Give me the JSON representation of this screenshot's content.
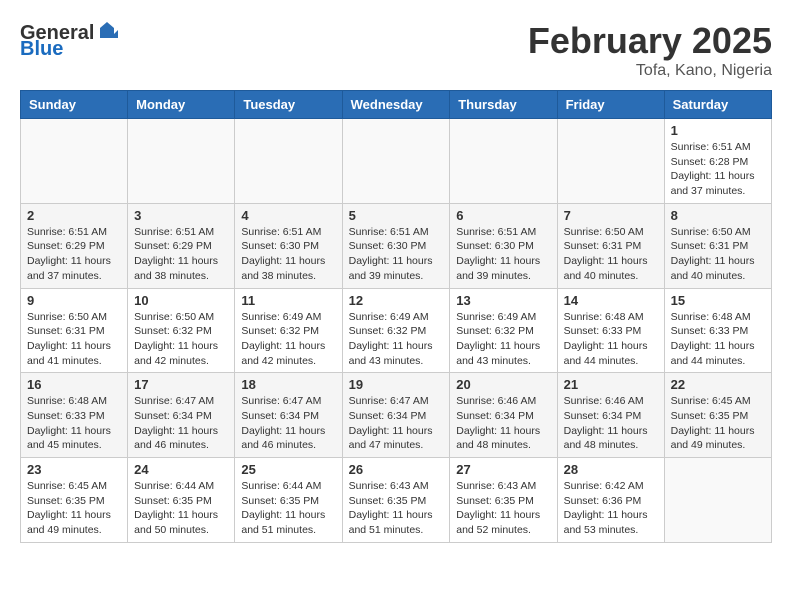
{
  "header": {
    "logo_general": "General",
    "logo_blue": "Blue",
    "month_year": "February 2025",
    "location": "Tofa, Kano, Nigeria"
  },
  "weekdays": [
    "Sunday",
    "Monday",
    "Tuesday",
    "Wednesday",
    "Thursday",
    "Friday",
    "Saturday"
  ],
  "weeks": [
    [
      {
        "day": "",
        "info": ""
      },
      {
        "day": "",
        "info": ""
      },
      {
        "day": "",
        "info": ""
      },
      {
        "day": "",
        "info": ""
      },
      {
        "day": "",
        "info": ""
      },
      {
        "day": "",
        "info": ""
      },
      {
        "day": "1",
        "info": "Sunrise: 6:51 AM\nSunset: 6:28 PM\nDaylight: 11 hours and 37 minutes."
      }
    ],
    [
      {
        "day": "2",
        "info": "Sunrise: 6:51 AM\nSunset: 6:29 PM\nDaylight: 11 hours and 37 minutes."
      },
      {
        "day": "3",
        "info": "Sunrise: 6:51 AM\nSunset: 6:29 PM\nDaylight: 11 hours and 38 minutes."
      },
      {
        "day": "4",
        "info": "Sunrise: 6:51 AM\nSunset: 6:30 PM\nDaylight: 11 hours and 38 minutes."
      },
      {
        "day": "5",
        "info": "Sunrise: 6:51 AM\nSunset: 6:30 PM\nDaylight: 11 hours and 39 minutes."
      },
      {
        "day": "6",
        "info": "Sunrise: 6:51 AM\nSunset: 6:30 PM\nDaylight: 11 hours and 39 minutes."
      },
      {
        "day": "7",
        "info": "Sunrise: 6:50 AM\nSunset: 6:31 PM\nDaylight: 11 hours and 40 minutes."
      },
      {
        "day": "8",
        "info": "Sunrise: 6:50 AM\nSunset: 6:31 PM\nDaylight: 11 hours and 40 minutes."
      }
    ],
    [
      {
        "day": "9",
        "info": "Sunrise: 6:50 AM\nSunset: 6:31 PM\nDaylight: 11 hours and 41 minutes."
      },
      {
        "day": "10",
        "info": "Sunrise: 6:50 AM\nSunset: 6:32 PM\nDaylight: 11 hours and 42 minutes."
      },
      {
        "day": "11",
        "info": "Sunrise: 6:49 AM\nSunset: 6:32 PM\nDaylight: 11 hours and 42 minutes."
      },
      {
        "day": "12",
        "info": "Sunrise: 6:49 AM\nSunset: 6:32 PM\nDaylight: 11 hours and 43 minutes."
      },
      {
        "day": "13",
        "info": "Sunrise: 6:49 AM\nSunset: 6:32 PM\nDaylight: 11 hours and 43 minutes."
      },
      {
        "day": "14",
        "info": "Sunrise: 6:48 AM\nSunset: 6:33 PM\nDaylight: 11 hours and 44 minutes."
      },
      {
        "day": "15",
        "info": "Sunrise: 6:48 AM\nSunset: 6:33 PM\nDaylight: 11 hours and 44 minutes."
      }
    ],
    [
      {
        "day": "16",
        "info": "Sunrise: 6:48 AM\nSunset: 6:33 PM\nDaylight: 11 hours and 45 minutes."
      },
      {
        "day": "17",
        "info": "Sunrise: 6:47 AM\nSunset: 6:34 PM\nDaylight: 11 hours and 46 minutes."
      },
      {
        "day": "18",
        "info": "Sunrise: 6:47 AM\nSunset: 6:34 PM\nDaylight: 11 hours and 46 minutes."
      },
      {
        "day": "19",
        "info": "Sunrise: 6:47 AM\nSunset: 6:34 PM\nDaylight: 11 hours and 47 minutes."
      },
      {
        "day": "20",
        "info": "Sunrise: 6:46 AM\nSunset: 6:34 PM\nDaylight: 11 hours and 48 minutes."
      },
      {
        "day": "21",
        "info": "Sunrise: 6:46 AM\nSunset: 6:34 PM\nDaylight: 11 hours and 48 minutes."
      },
      {
        "day": "22",
        "info": "Sunrise: 6:45 AM\nSunset: 6:35 PM\nDaylight: 11 hours and 49 minutes."
      }
    ],
    [
      {
        "day": "23",
        "info": "Sunrise: 6:45 AM\nSunset: 6:35 PM\nDaylight: 11 hours and 49 minutes."
      },
      {
        "day": "24",
        "info": "Sunrise: 6:44 AM\nSunset: 6:35 PM\nDaylight: 11 hours and 50 minutes."
      },
      {
        "day": "25",
        "info": "Sunrise: 6:44 AM\nSunset: 6:35 PM\nDaylight: 11 hours and 51 minutes."
      },
      {
        "day": "26",
        "info": "Sunrise: 6:43 AM\nSunset: 6:35 PM\nDaylight: 11 hours and 51 minutes."
      },
      {
        "day": "27",
        "info": "Sunrise: 6:43 AM\nSunset: 6:35 PM\nDaylight: 11 hours and 52 minutes."
      },
      {
        "day": "28",
        "info": "Sunrise: 6:42 AM\nSunset: 6:36 PM\nDaylight: 11 hours and 53 minutes."
      },
      {
        "day": "",
        "info": ""
      }
    ]
  ]
}
